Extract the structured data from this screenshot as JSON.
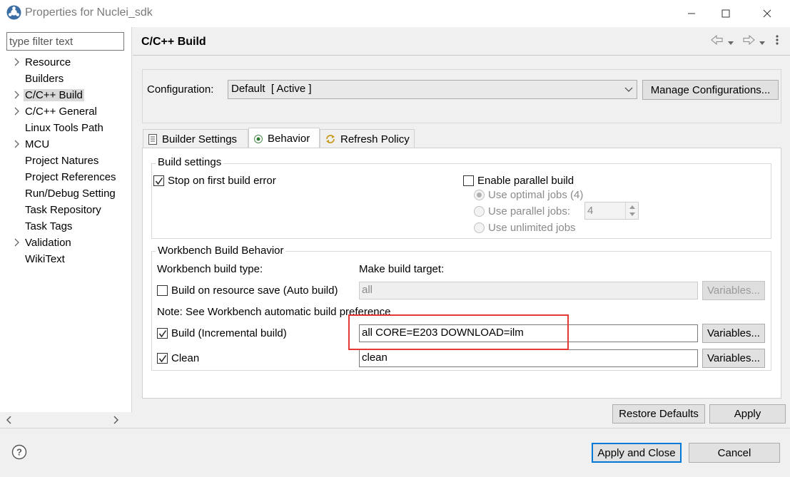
{
  "window": {
    "title": "Properties for Nuclei_sdk",
    "icon": "eclipse-app-icon",
    "controls": [
      "minimize-icon",
      "maximize-icon",
      "close-icon"
    ]
  },
  "sidebar": {
    "filter_placeholder": "type filter text",
    "items": [
      {
        "label": "Resource",
        "expandable": true
      },
      {
        "label": "Builders",
        "expandable": false
      },
      {
        "label": "C/C++ Build",
        "expandable": true,
        "selected": true
      },
      {
        "label": "C/C++ General",
        "expandable": true
      },
      {
        "label": "Linux Tools Path",
        "expandable": false
      },
      {
        "label": "MCU",
        "expandable": true
      },
      {
        "label": "Project Natures",
        "expandable": false
      },
      {
        "label": "Project References",
        "expandable": false
      },
      {
        "label": "Run/Debug Setting",
        "expandable": false
      },
      {
        "label": "Task Repository",
        "expandable": false
      },
      {
        "label": "Task Tags",
        "expandable": false
      },
      {
        "label": "Validation",
        "expandable": true
      },
      {
        "label": "WikiText",
        "expandable": false
      }
    ]
  },
  "header": {
    "title": "C/C++ Build",
    "nav_icons": [
      "back-arrow-icon",
      "dropdown-icon",
      "forward-arrow-icon",
      "dropdown-icon",
      "view-menu-icon"
    ]
  },
  "configuration": {
    "label": "Configuration:",
    "selected": "Default  [ Active ]",
    "manage_button": "Manage Configurations..."
  },
  "tabs": [
    {
      "label": "Builder Settings",
      "icon": "builder-settings-icon",
      "active": false
    },
    {
      "label": "Behavior",
      "icon": "behavior-radio-icon",
      "active": true
    },
    {
      "label": "Refresh Policy",
      "icon": "refresh-policy-icon",
      "active": false
    }
  ],
  "build_settings": {
    "title": "Build settings",
    "stop_on_error": {
      "label": "Stop on first build error",
      "checked": true
    },
    "parallel": {
      "label": "Enable parallel build",
      "checked": false
    },
    "optimal_jobs": "Use optimal jobs (4)",
    "parallel_jobs": "Use parallel jobs:",
    "parallel_jobs_value": "4",
    "unlimited_jobs": "Use unlimited jobs"
  },
  "workbench": {
    "title": "Workbench Build Behavior",
    "build_type_label": "Workbench build type:",
    "make_target_label": "Make build target:",
    "auto_build": {
      "label": "Build on resource save (Auto build)",
      "checked": false,
      "target": "all"
    },
    "note": "Note: See Workbench automatic build preference",
    "incremental": {
      "label": "Build (Incremental build)",
      "checked": true,
      "target": "all CORE=E203 DOWNLOAD=ilm"
    },
    "clean": {
      "label": "Clean",
      "checked": true,
      "target": "clean"
    },
    "variables_label": "Variables..."
  },
  "actions": {
    "restore_defaults": "Restore Defaults",
    "apply": "Apply",
    "apply_and_close": "Apply and Close",
    "cancel": "Cancel"
  },
  "colors": {
    "highlight_box": "#e53935",
    "default_button_border": "#0078d7"
  }
}
